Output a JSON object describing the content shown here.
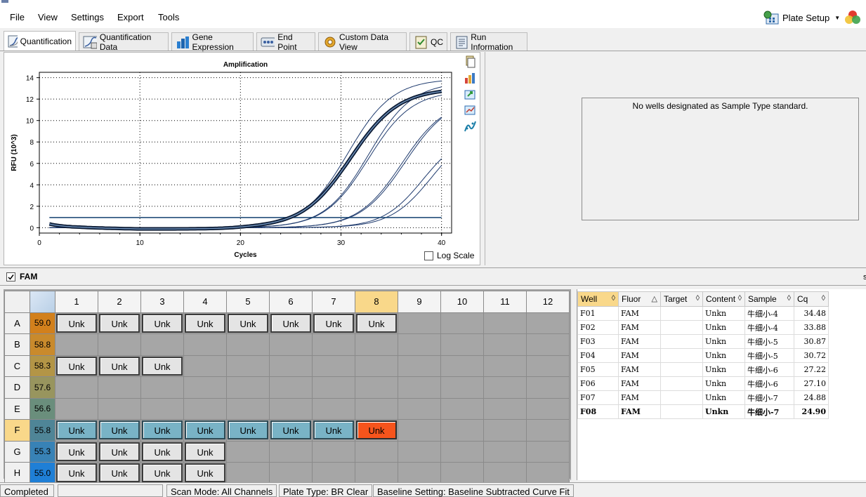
{
  "menu": {
    "file": "File",
    "view": "View",
    "settings": "Settings",
    "export": "Export",
    "tools": "Tools",
    "plate_setup": "Plate Setup"
  },
  "tabs": [
    {
      "label": "Quantification",
      "icon": "amplification-curve-icon",
      "active": true
    },
    {
      "label": "Quantification Data",
      "icon": "quantification-data-icon"
    },
    {
      "label": "Gene Expression",
      "icon": "bar-chart-icon"
    },
    {
      "label": "End Point",
      "icon": "end-point-icon"
    },
    {
      "label": "Custom Data View",
      "icon": "gear-icon"
    },
    {
      "label": "QC",
      "icon": "checklist-icon"
    },
    {
      "label": "Run Information",
      "icon": "run-information-icon"
    }
  ],
  "chart_data": {
    "type": "line",
    "title": "Amplification",
    "xlabel": "Cycles",
    "ylabel": "RFU (10^3)",
    "xlim": [
      0,
      41
    ],
    "ylim": [
      -0.5,
      14.5
    ],
    "xticks": [
      0,
      10,
      20,
      30,
      40
    ],
    "yticks": [
      0,
      2,
      4,
      6,
      8,
      10,
      12,
      14
    ],
    "threshold": 0.95,
    "grid": true,
    "series": [
      {
        "well": "F01",
        "cq": 34.48,
        "plateau": 9.5,
        "k": 0.48
      },
      {
        "well": "F02",
        "cq": 33.88,
        "plateau": 9.0,
        "k": 0.5
      },
      {
        "well": "F03",
        "cq": 30.87,
        "plateau": 12.2,
        "k": 0.45
      },
      {
        "well": "F04",
        "cq": 30.72,
        "plateau": 12.0,
        "k": 0.46
      },
      {
        "well": "F05",
        "cq": 27.22,
        "plateau": 12.8,
        "k": 0.46
      },
      {
        "well": "F06",
        "cq": 27.1,
        "plateau": 13.6,
        "k": 0.46
      },
      {
        "well": "F07",
        "cq": 24.88,
        "plateau": 13.9,
        "k": 0.45
      },
      {
        "well": "F08",
        "cq": 24.9,
        "plateau": 13.0,
        "k": 0.42,
        "highlight": true
      }
    ]
  },
  "log_scale_label": "Log Scale",
  "standard_message": "No wells designated as Sample Type standard.",
  "fluor_label": "FAM",
  "plate": {
    "columns": [
      "1",
      "2",
      "3",
      "4",
      "5",
      "6",
      "7",
      "8",
      "9",
      "10",
      "11",
      "12"
    ],
    "rows": [
      {
        "label": "A",
        "temp": "59.0",
        "color": "#d2801c",
        "cells": [
          "Unk",
          "Unk",
          "Unk",
          "Unk",
          "Unk",
          "Unk",
          "Unk",
          "Unk",
          "",
          "",
          "",
          ""
        ]
      },
      {
        "label": "B",
        "temp": "58.8",
        "color": "#c98a2c",
        "cells": [
          "",
          "",
          "",
          "",
          "",
          "",
          "",
          "",
          "",
          "",
          "",
          ""
        ]
      },
      {
        "label": "C",
        "temp": "58.3",
        "color": "#b39546",
        "cells": [
          "Unk",
          "Unk",
          "Unk",
          "",
          "",
          "",
          "",
          "",
          "",
          "",
          "",
          ""
        ]
      },
      {
        "label": "D",
        "temp": "57.6",
        "color": "#98955e",
        "cells": [
          "",
          "",
          "",
          "",
          "",
          "",
          "",
          "",
          "",
          "",
          "",
          ""
        ]
      },
      {
        "label": "E",
        "temp": "56.6",
        "color": "#6a8e7c",
        "cells": [
          "",
          "",
          "",
          "",
          "",
          "",
          "",
          "",
          "",
          "",
          "",
          ""
        ]
      },
      {
        "label": "F",
        "temp": "55.8",
        "color": "#4f8597",
        "cells": [
          "Unk",
          "Unk",
          "Unk",
          "Unk",
          "Unk",
          "Unk",
          "Unk",
          "Unk",
          "",
          "",
          "",
          ""
        ]
      },
      {
        "label": "G",
        "temp": "55.3",
        "color": "#3882b6",
        "cells": [
          "Unk",
          "Unk",
          "Unk",
          "Unk",
          "",
          "",
          "",
          "",
          "",
          "",
          "",
          ""
        ]
      },
      {
        "label": "H",
        "temp": "55.0",
        "color": "#1f7fd6",
        "cells": [
          "Unk",
          "Unk",
          "Unk",
          "Unk",
          "",
          "",
          "",
          "",
          "",
          "",
          "",
          ""
        ]
      }
    ]
  },
  "results": {
    "headers": [
      "Well",
      "Fluor",
      "Target",
      "Content",
      "Sample",
      "Cq"
    ],
    "rows": [
      {
        "well": "F01",
        "fluor": "FAM",
        "target": "",
        "content": "Unkn",
        "sample": "牛细小-4",
        "cq": "34.48"
      },
      {
        "well": "F02",
        "fluor": "FAM",
        "target": "",
        "content": "Unkn",
        "sample": "牛细小-4",
        "cq": "33.88"
      },
      {
        "well": "F03",
        "fluor": "FAM",
        "target": "",
        "content": "Unkn",
        "sample": "牛细小-5",
        "cq": "30.87"
      },
      {
        "well": "F04",
        "fluor": "FAM",
        "target": "",
        "content": "Unkn",
        "sample": "牛细小-5",
        "cq": "30.72"
      },
      {
        "well": "F05",
        "fluor": "FAM",
        "target": "",
        "content": "Unkn",
        "sample": "牛细小-6",
        "cq": "27.22"
      },
      {
        "well": "F06",
        "fluor": "FAM",
        "target": "",
        "content": "Unkn",
        "sample": "牛细小-6",
        "cq": "27.10"
      },
      {
        "well": "F07",
        "fluor": "FAM",
        "target": "",
        "content": "Unkn",
        "sample": "牛细小-7",
        "cq": "24.88"
      },
      {
        "well": "F08",
        "fluor": "FAM",
        "target": "",
        "content": "Unkn",
        "sample": "牛细小-7",
        "cq": "24.90",
        "bold": true
      }
    ]
  },
  "status": {
    "state": "Completed",
    "scan_mode": "Scan Mode: All Channels",
    "plate_type": "Plate Type: BR Clear",
    "baseline": "Baseline Setting: Baseline Subtracted Curve Fit"
  }
}
